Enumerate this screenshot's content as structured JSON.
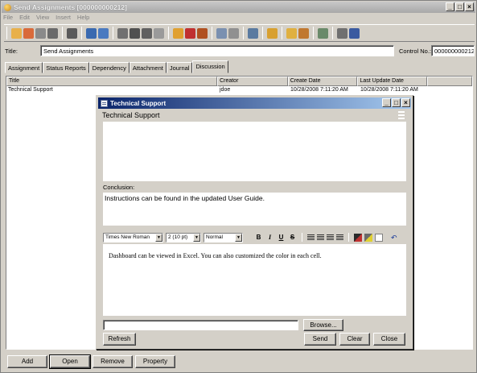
{
  "window": {
    "title": "Send Assignments [000000000212]",
    "controls": {
      "minimize": "_",
      "restore": "□",
      "close": "×"
    }
  },
  "menu": [
    "File",
    "Edit",
    "View",
    "Insert",
    "Help"
  ],
  "form": {
    "title_label": "Title:",
    "title_value": "Send Assignments",
    "control_label": "Control No.:",
    "control_value": "000000000212"
  },
  "tabs": [
    "Assignment",
    "Status Reports",
    "Dependency",
    "Attachment",
    "Journal",
    "Discussion"
  ],
  "active_tab": "Discussion",
  "grid": {
    "columns": [
      "Title",
      "Creator",
      "Create Date",
      "Last Update Date"
    ],
    "rows": [
      [
        "Technical Support",
        "jdoe",
        "10/28/2008 7:11:20 AM",
        "10/28/2008 7:11:20 AM"
      ]
    ]
  },
  "bottom_buttons": [
    "Add",
    "Open",
    "Remove",
    "Property"
  ],
  "dialog": {
    "title": "Technical Support",
    "subject": "Technical Support",
    "conclusion_label": "Conclusion:",
    "conclusion_text": "Instructions can be found in the updated User Guide.",
    "font_name": "Times New Roman",
    "font_size": "2 (10 pt)",
    "style": "Normal",
    "format_buttons": [
      "B",
      "I",
      "U",
      "S"
    ],
    "body_text": "Dashboard can be viewed in Excel.  You can also customized the color in each cell.",
    "attachment_value": "",
    "browse_label": "Browse...",
    "refresh_label": "Refresh",
    "send_label": "Send",
    "clear_label": "Clear",
    "close_label": "Close"
  }
}
